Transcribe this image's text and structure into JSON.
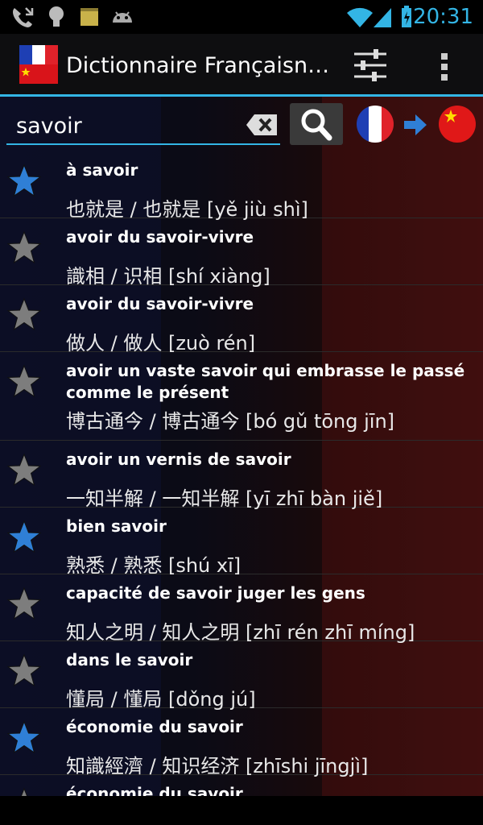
{
  "app": {
    "title": "Dictionnaire Françaisn…"
  },
  "status": {
    "time": "20:31"
  },
  "search": {
    "value": "savoir"
  },
  "colors": {
    "accent": "#33b5e5",
    "star_blue": "#2f7fd6",
    "star_gray": "#7d7d7d"
  },
  "entries": [
    {
      "fr": "à savoir",
      "zh": "也就是 / 也就是 [yě jiù shì]",
      "starred": true
    },
    {
      "fr": "avoir du savoir-vivre",
      "zh": "識相 / 识相 [shí xiàng]",
      "starred": false
    },
    {
      "fr": "avoir du savoir-vivre",
      "zh": "做人 / 做人 [zuò rén]",
      "starred": false
    },
    {
      "fr": "avoir un vaste savoir qui embrasse le passé comme le présent",
      "zh": "博古通今 / 博古通今 [bó gǔ tōng jīn]",
      "starred": false
    },
    {
      "fr": "avoir un vernis de savoir",
      "zh": "一知半解 / 一知半解 [yī zhī bàn jiě]",
      "starred": false
    },
    {
      "fr": "bien savoir",
      "zh": "熟悉 / 熟悉 [shú xī]",
      "starred": true
    },
    {
      "fr": "capacité de savoir juger les gens",
      "zh": "知人之明 / 知人之明 [zhī rén zhī míng]",
      "starred": false
    },
    {
      "fr": "dans le savoir",
      "zh": "懂局 / 懂局 [dǒng jú]",
      "starred": false
    },
    {
      "fr": "économie du savoir",
      "zh": "知識經濟 / 知识经济 [zhīshi jīngjì]",
      "starred": true
    },
    {
      "fr": "économie du savoir",
      "zh": "",
      "starred": false
    }
  ]
}
